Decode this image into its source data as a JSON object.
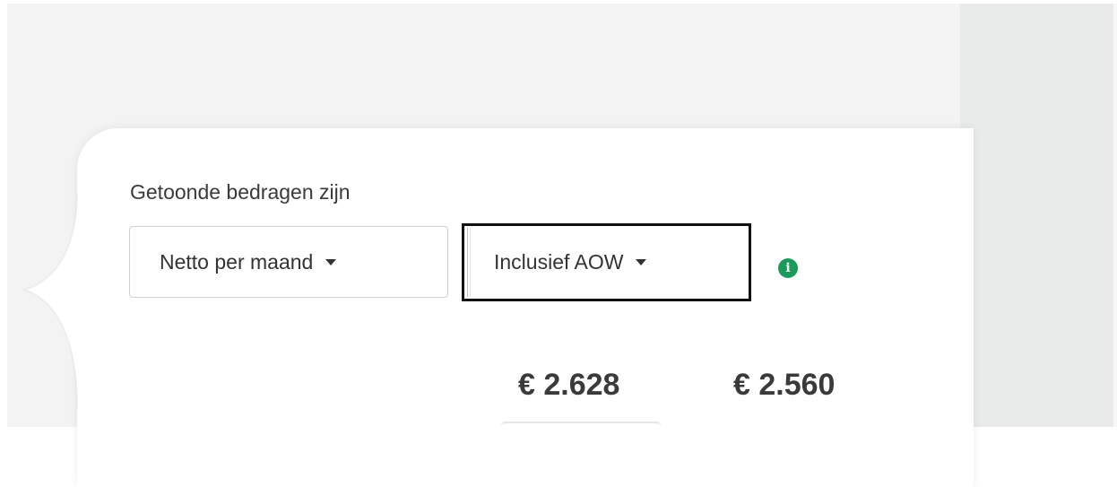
{
  "settings": {
    "label": "Getoonde bedragen zijn",
    "period_dropdown": {
      "selected": "Netto per maand",
      "icon": "caret-down-icon"
    },
    "aow_dropdown": {
      "selected": "Inclusief AOW",
      "icon": "caret-down-icon"
    },
    "info_icon": {
      "glyph": "i",
      "icon": "info-icon"
    }
  },
  "amounts": [
    {
      "value": "€ 2.628"
    },
    {
      "value": "€ 2.560"
    }
  ],
  "colors": {
    "page_background": "#f3f3f3",
    "right_panel": "#e9ebea",
    "card": "#ffffff",
    "info_accent": "#1c9a5b",
    "focus_outline": "#111111"
  }
}
